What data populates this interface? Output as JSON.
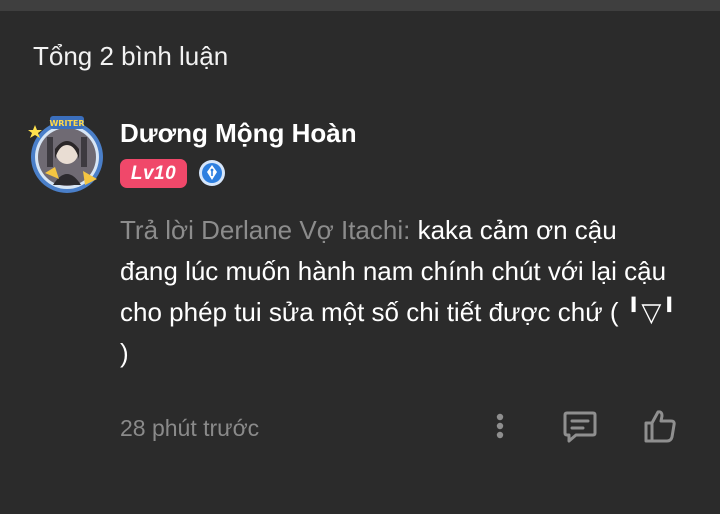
{
  "header": {
    "total_comments": "Tổng 2 bình luận"
  },
  "comment": {
    "author": "Dương Mộng Hoàn",
    "level": "Lv10",
    "avatar_badge_text": "WRITER",
    "reply_prefix": "Trả lời Derlane Vợ Itachi:",
    "text": "kaka cảm ơn cậu đang lúc muốn hành nam chính chút với lại cậu cho phép tui sửa một số chi tiết được chứ ( ╹▽╹ )",
    "time": "28 phút trước"
  },
  "icons": {
    "more": "more-vertical-icon",
    "reply": "comment-icon",
    "like": "thumbs-up-icon",
    "writer": "pen-badge-icon"
  },
  "colors": {
    "background": "#2b2b2b",
    "level_badge": "#f0486a",
    "muted_text": "#8c8c8c",
    "icon_gray": "#8f8f8f",
    "writer_badge": "#2d7fe0"
  }
}
